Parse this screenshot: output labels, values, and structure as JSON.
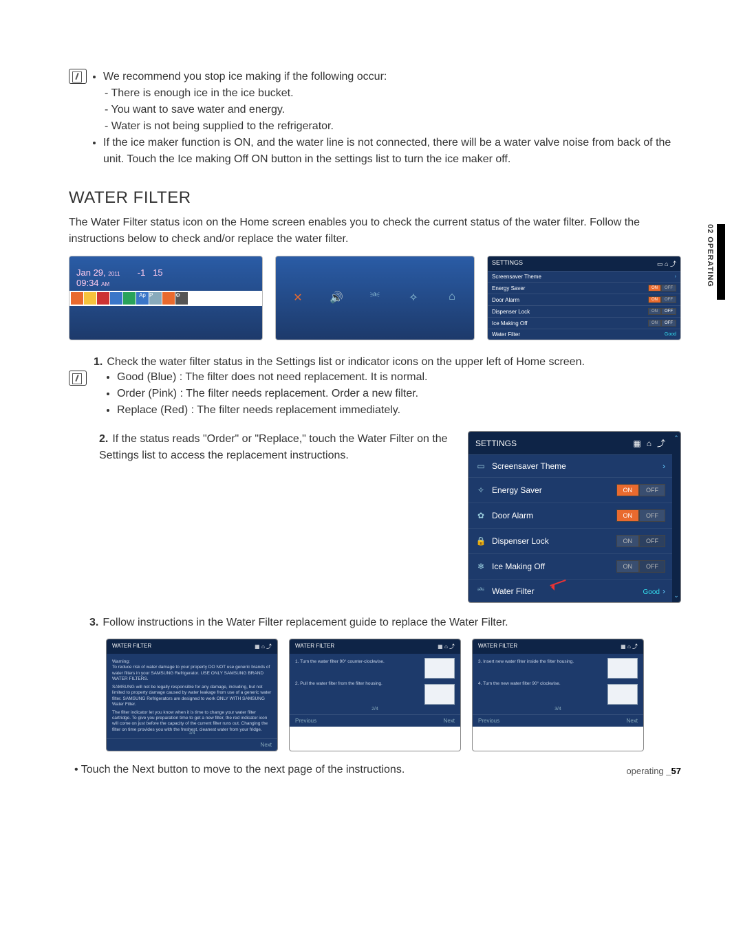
{
  "top_note": {
    "bullet1": "We recommend you stop ice making if the following occur:",
    "dash1": "There is enough ice in the ice bucket.",
    "dash2": "You want to save water and energy.",
    "dash3": "Water is not being supplied to the refrigerator.",
    "bullet2": "If the ice maker function is ON, and the water line is not connected, there will be a water valve noise from back of the unit. Touch the Ice making Off ON button in the settings list to turn the ice maker off."
  },
  "section_title": "WATER FILTER",
  "intro": "The Water Filter status icon on the Home screen enables you to check the current status of the water filter. Follow the instructions below to check and/or replace the water filter.",
  "home_panel": {
    "date": "Jan 29,",
    "year": "2011",
    "time": "09:34",
    "ampm": "AM",
    "t1": "-1",
    "t2": "15"
  },
  "settings_small": {
    "title": "SETTINGS",
    "rows": [
      "Screensaver Theme",
      "Energy Saver",
      "Door Alarm",
      "Dispenser Lock",
      "Ice Making Off",
      "Water Filter"
    ],
    "on": "ON",
    "off": "OFF",
    "good": "Good"
  },
  "step1": {
    "text": "Check the water filter status in the Settings list or indicator icons on the upper left of Home screen.",
    "b1": "Good (Blue) : The filter does not need replacement. It is normal.",
    "b2": "Order (Pink) : The filter needs replacement. Order a new filter.",
    "b3": "Replace (Red) : The filter needs replacement immediately."
  },
  "step2": {
    "text": "If the status reads \"Order\" or \"Replace,\" touch the Water Filter on the Settings list to access the replacement instructions."
  },
  "big_settings": {
    "title": "SETTINGS",
    "rows": [
      {
        "icon": "▭",
        "label": "Screensaver Theme",
        "toggle": false,
        "chev": true
      },
      {
        "icon": "✧",
        "label": "Energy Saver",
        "toggle": true,
        "on": true
      },
      {
        "icon": "✿",
        "label": "Door Alarm",
        "toggle": true,
        "on": true
      },
      {
        "icon": "🔒",
        "label": "Dispenser Lock",
        "toggle": true,
        "on": false
      },
      {
        "icon": "❄",
        "label": "Ice Making Off",
        "toggle": true,
        "on": false
      },
      {
        "icon": "⎃",
        "label": "Water Filter",
        "toggle": false,
        "good": true
      }
    ],
    "on": "ON",
    "off": "OFF",
    "good": "Good"
  },
  "step3": "Follow instructions in the Water Filter replacement guide to replace the Water Filter.",
  "wf_cards": {
    "title": "WATER FILTER",
    "card1": {
      "warn_h": "Warning:",
      "warn": "To reduce risk of water damage to your property DO NOT use generic brands of water filters in your SAMSUNG Refrigerator. USE ONLY SAMSUNG BRAND WATER FILTERS.",
      "p2": "SAMSUNG will not be legally responsible for any damage, including, but not limited to property damage caused by water leakage from use of a generic water filter. SAMSUNG Refrigerators are designed to work ONLY WITH SAMSUNG Water Filter.",
      "p3": "The filter indicator let you know when it is time to change your water filter cartridge. To give you preparation time to get a new filter, the red indicator icon will come on just before the capacity of the current filter runs out. Changing the filter on time provides you with the freshest, cleanest water from your fridge.",
      "pg": "1/4",
      "next": "Next"
    },
    "card2": {
      "s1": "1. Turn the water filter 90° counter-clockwise.",
      "s2": "2. Pull the water filter from the filter housing.",
      "pg": "2/4",
      "prev": "Previous",
      "next": "Next"
    },
    "card3": {
      "s3": "3. Insert new water filter inside the filter housing.",
      "s4": "4. Turn the new water filter 90° clockwise.",
      "pg": "3/4",
      "prev": "Previous",
      "next": "Next"
    }
  },
  "final": "Touch the Next button to move to the next page of the instructions.",
  "side_tab": "02 OPERATING",
  "footer": {
    "word": "operating",
    "page": "_57"
  }
}
